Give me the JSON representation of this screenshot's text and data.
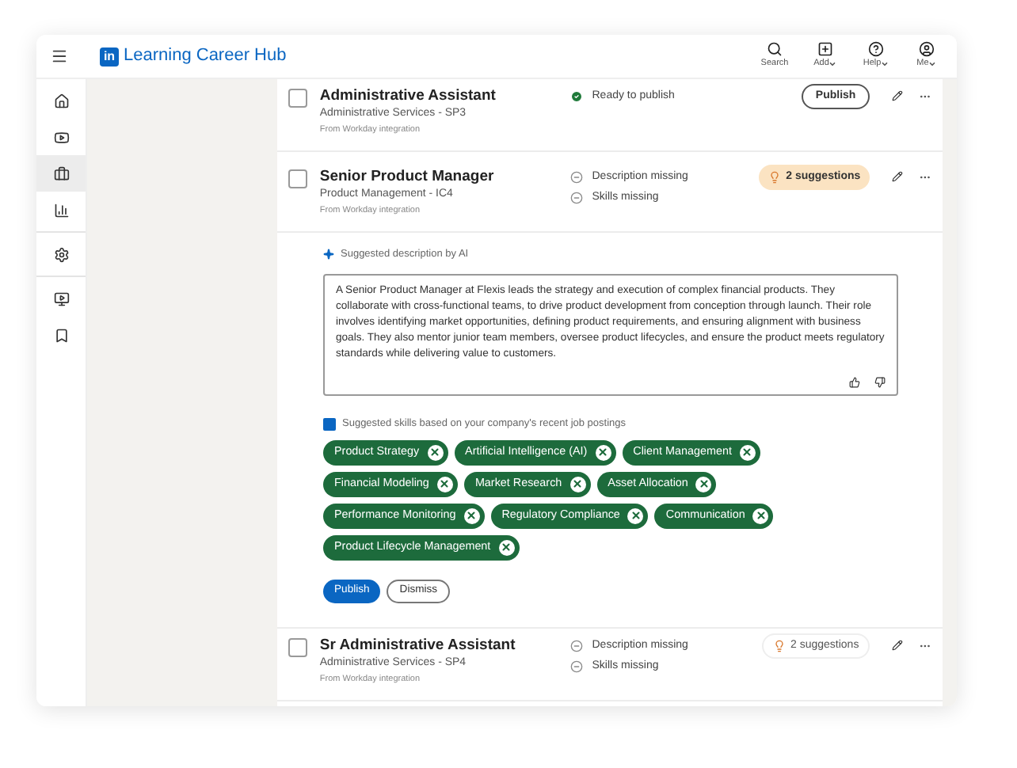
{
  "header": {
    "logo": "in",
    "title": "Learning Career Hub",
    "actions": [
      {
        "kind": "search",
        "label": "Search",
        "dropdown": false
      },
      {
        "kind": "add",
        "label": "Add",
        "dropdown": true
      },
      {
        "kind": "help",
        "label": "Help",
        "dropdown": true
      },
      {
        "kind": "me",
        "label": "Me",
        "dropdown": true
      }
    ]
  },
  "sidebar": {
    "sections": [
      {
        "items": [
          {
            "kind": "home",
            "selected": false
          },
          {
            "kind": "video",
            "selected": false
          },
          {
            "kind": "briefcase",
            "selected": true
          },
          {
            "kind": "chart",
            "selected": false
          }
        ]
      },
      {
        "items": [
          {
            "kind": "gear",
            "selected": false
          }
        ]
      },
      {
        "items": [
          {
            "kind": "media",
            "selected": false
          },
          {
            "kind": "bookmark",
            "selected": false
          }
        ]
      }
    ]
  },
  "jobs": [
    {
      "title": "Administrative Assistant",
      "subtitle": "Administrative Services - SP3",
      "source": "From Workday integration",
      "checked": false,
      "statuses": [
        {
          "kind": "ready",
          "text": "Ready to publish"
        }
      ],
      "action": {
        "kind": "publish",
        "label": "Publish"
      }
    },
    {
      "title": "Senior Product Manager",
      "subtitle": "Product Management - IC4",
      "source": "From Workday integration",
      "checked": false,
      "statuses": [
        {
          "kind": "missing",
          "text": "Description missing"
        },
        {
          "kind": "missing",
          "text": "Skills missing"
        }
      ],
      "action": {
        "kind": "suggestions",
        "label": "2 suggestions",
        "highlighted": true
      },
      "panel": {
        "ai_label": "Suggested description by AI",
        "description": "A Senior Product Manager at Flexis leads the strategy and execution of complex financial products. They collaborate with cross-functional teams, to drive product development from conception through launch. Their role involves identifying market opportunities, defining product requirements, and ensuring alignment with business goals. They also mentor junior team members, oversee product lifecycles, and ensure the product meets regulatory standards while delivering value to customers.",
        "skills_label": "Suggested skills based on your company's recent job postings",
        "skills": [
          "Product Strategy",
          "Artificial Intelligence (AI)",
          "Client Management",
          "Financial Modeling",
          "Market Research",
          "Asset Allocation",
          "Performance Monitoring",
          "Regulatory Compliance",
          "Communication",
          "Product Lifecycle Management"
        ],
        "buttons": [
          {
            "kind": "primary",
            "label": "Publish"
          },
          {
            "kind": "secondary",
            "label": "Dismiss"
          }
        ]
      }
    },
    {
      "title": "Sr Administrative Assistant",
      "subtitle": "Administrative Services - SP4",
      "source": "From Workday integration",
      "checked": false,
      "statuses": [
        {
          "kind": "missing",
          "text": "Description missing"
        },
        {
          "kind": "missing",
          "text": "Skills missing"
        }
      ],
      "action": {
        "kind": "suggestions",
        "label": "2 suggestions",
        "highlighted": false
      }
    }
  ]
}
